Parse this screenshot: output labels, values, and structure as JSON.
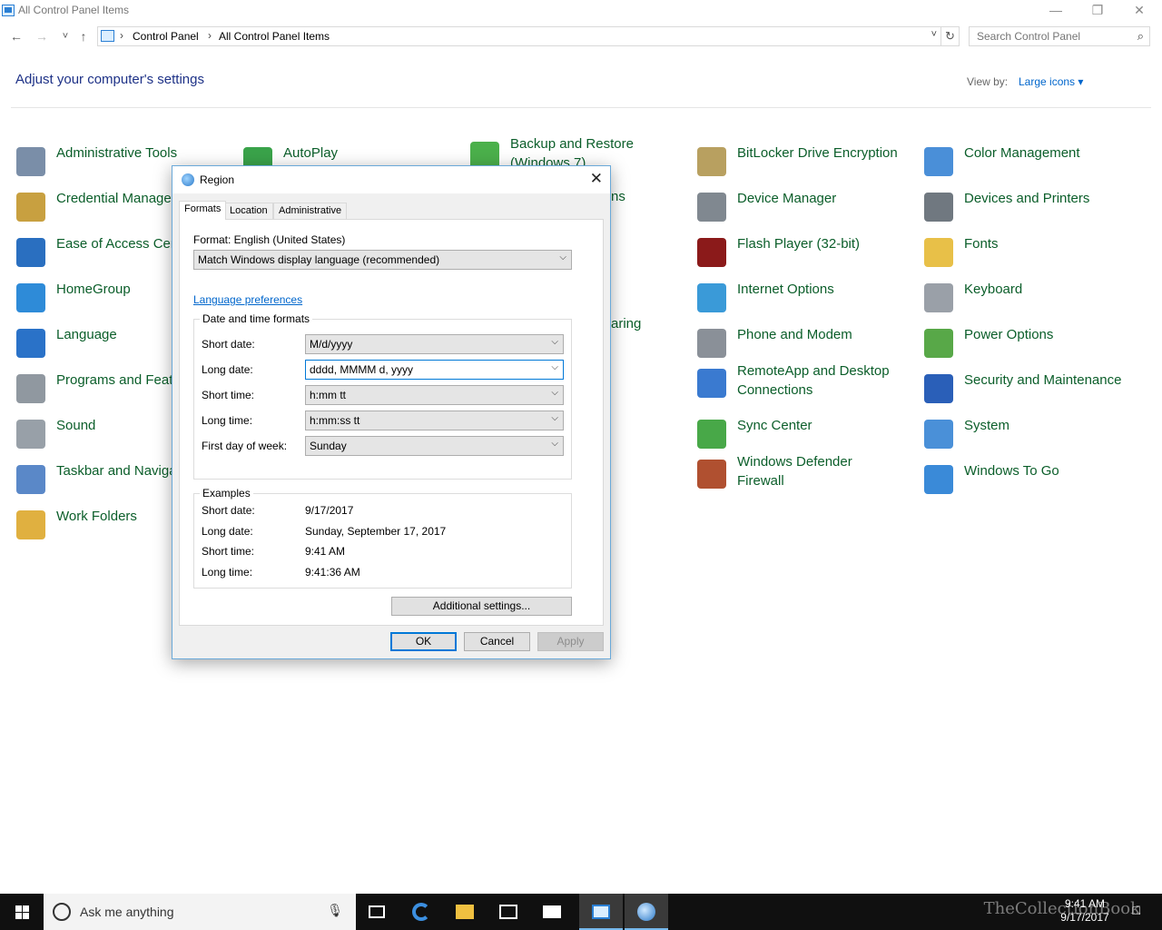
{
  "window": {
    "title": "All Control Panel Items",
    "minimize_glyph": "—",
    "restore_glyph": "❐",
    "close_glyph": "✕"
  },
  "navigation": {
    "back_glyph": "←",
    "forward_glyph": "→",
    "recent_glyph": "˅",
    "up_glyph": "↑",
    "breadcrumb": [
      "Control Panel",
      "All Control Panel Items"
    ],
    "breadcrumb_sep": "›",
    "dropdown_glyph": "˅",
    "refresh_glyph": "↻",
    "search_placeholder": "Search Control Panel",
    "search_glyph": "⌕"
  },
  "header": {
    "heading": "Adjust your computer's settings",
    "view_by_label": "View by:",
    "view_by_value": "Large icons"
  },
  "items": [
    {
      "label": "Administrative Tools",
      "icon": "administrative-tools-icon",
      "color": "#7a8ea8"
    },
    {
      "label": "AutoPlay",
      "icon": "autoplay-icon",
      "color": "#3aa34a"
    },
    {
      "label": "Backup and Restore (Windows 7)",
      "icon": "backup-restore-icon",
      "color": "#4bb04b"
    },
    {
      "label": "BitLocker Drive Encryption",
      "icon": "bitlocker-icon",
      "color": "#b8a060"
    },
    {
      "label": "Color Management",
      "icon": "color-management-icon",
      "color": "#4a8fd8"
    },
    {
      "label": "Credential Manager",
      "icon": "credential-manager-icon",
      "color": "#c8a040"
    },
    {
      "label": "Device Manager",
      "icon": "device-manager-icon",
      "color": "#808890"
    },
    {
      "label": "Devices and Printers",
      "icon": "devices-printers-icon",
      "color": "#707880"
    },
    {
      "label": "Ease of Access Center",
      "icon": "ease-of-access-icon",
      "color": "#2a6fc0"
    },
    {
      "label": "Flash Player (32-bit)",
      "icon": "flash-player-icon",
      "color": "#8b1a1a"
    },
    {
      "label": "Fonts",
      "icon": "fonts-icon",
      "color": "#e8c048"
    },
    {
      "label": "HomeGroup",
      "icon": "homegroup-icon",
      "color": "#2e8bd8"
    },
    {
      "label": "Internet Options",
      "icon": "internet-options-icon",
      "color": "#3a9ad8"
    },
    {
      "label": "Keyboard",
      "icon": "keyboard-icon",
      "color": "#9aa0a8"
    },
    {
      "label": "Language",
      "icon": "language-icon",
      "color": "#2a72c8"
    },
    {
      "label": "Phone and Modem",
      "icon": "phone-modem-icon",
      "color": "#8a9098"
    },
    {
      "label": "Power Options",
      "icon": "power-options-icon",
      "color": "#58a848"
    },
    {
      "label": "Programs and Features",
      "icon": "programs-features-icon",
      "color": "#9098a0"
    },
    {
      "label": "RemoteApp and Desktop Connections",
      "icon": "remoteapp-icon",
      "color": "#3a7ad0"
    },
    {
      "label": "Security and Maintenance",
      "icon": "security-maintenance-icon",
      "color": "#2a5fb8"
    },
    {
      "label": "Sound",
      "icon": "sound-icon",
      "color": "#98a0a8"
    },
    {
      "label": "Sync Center",
      "icon": "sync-center-icon",
      "color": "#48a848"
    },
    {
      "label": "System",
      "icon": "system-icon",
      "color": "#4a90d8"
    },
    {
      "label": "Taskbar and Navigation",
      "icon": "taskbar-navigation-icon",
      "color": "#5a88c8"
    },
    {
      "label": "Windows Defender Firewall",
      "icon": "firewall-icon",
      "color": "#b05030"
    },
    {
      "label": "Windows To Go",
      "icon": "windows-to-go-icon",
      "color": "#3a8ad8"
    },
    {
      "label": "Work Folders",
      "icon": "work-folders-icon",
      "color": "#e0b040"
    }
  ],
  "hidden_labels": {
    "col3_row2_tail": "ns",
    "col3_row5_tail": "aring"
  },
  "dialog": {
    "title": "Region",
    "close_glyph": "✕",
    "tabs": [
      "Formats",
      "Location",
      "Administrative"
    ],
    "format_label": "Format: English (United States)",
    "format_value": "Match Windows display language (recommended)",
    "language_link": "Language preferences",
    "date_time_group": "Date and time formats",
    "fields": [
      {
        "label": "Short date:",
        "value": "M/d/yyyy"
      },
      {
        "label": "Long date:",
        "value": "dddd, MMMM d, yyyy"
      },
      {
        "label": "Short time:",
        "value": "h:mm tt"
      },
      {
        "label": "Long time:",
        "value": "h:mm:ss tt"
      },
      {
        "label": "First day of week:",
        "value": "Sunday"
      }
    ],
    "examples_group": "Examples",
    "examples": [
      {
        "label": "Short date:",
        "value": "9/17/2017"
      },
      {
        "label": "Long date:",
        "value": "Sunday, September 17, 2017"
      },
      {
        "label": "Short time:",
        "value": "9:41 AM"
      },
      {
        "label": "Long time:",
        "value": "9:41:36 AM"
      }
    ],
    "additional_settings": "Additional settings...",
    "ok": "OK",
    "cancel": "Cancel",
    "apply": "Apply",
    "chevron_glyph": "⌵"
  },
  "taskbar": {
    "search_placeholder": "Ask me anything",
    "mic_glyph": "🎙",
    "time": "9:41 AM",
    "date": "9/17/2017",
    "watermark": "TheCollectionBook"
  }
}
